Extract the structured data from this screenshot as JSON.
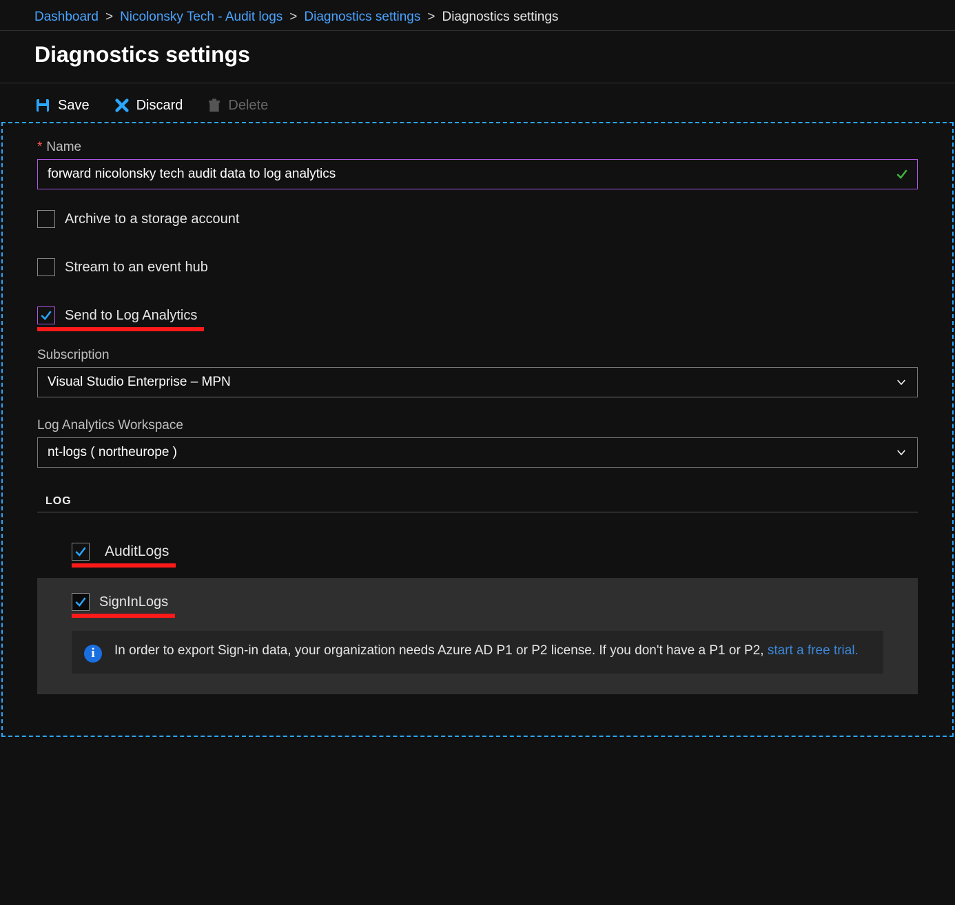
{
  "breadcrumb": {
    "items": [
      "Dashboard",
      "Nicolonsky Tech - Audit logs",
      "Diagnostics settings"
    ],
    "current": "Diagnostics settings"
  },
  "page": {
    "title": "Diagnostics settings"
  },
  "toolbar": {
    "save_label": "Save",
    "discard_label": "Discard",
    "delete_label": "Delete"
  },
  "form": {
    "name_label": "Name",
    "name_value": "forward nicolonsky tech audit data to log analytics",
    "archive_label": "Archive to a storage account",
    "archive_checked": false,
    "stream_label": "Stream to an event hub",
    "stream_checked": false,
    "log_analytics_label": "Send to Log Analytics",
    "log_analytics_checked": true
  },
  "subscription": {
    "label": "Subscription",
    "value": "Visual Studio Enterprise – MPN"
  },
  "workspace": {
    "label": "Log Analytics Workspace",
    "value": "nt-logs ( northeurope )"
  },
  "log": {
    "heading": "LOG",
    "items": [
      {
        "name": "AuditLogs",
        "checked": true
      },
      {
        "name": "SignInLogs",
        "checked": true
      }
    ]
  },
  "info": {
    "text_before": "In order to export Sign-in data, your organization needs Azure AD P1 or P2 license. If you don't have a P1 or P2, ",
    "link_text": "start a free trial."
  },
  "colors": {
    "accent_blue": "#2aa6ff",
    "link_blue": "#4aa3ff",
    "purple": "#b055e6",
    "highlight_red": "#ff1a1a",
    "success_green": "#3fb43f"
  }
}
